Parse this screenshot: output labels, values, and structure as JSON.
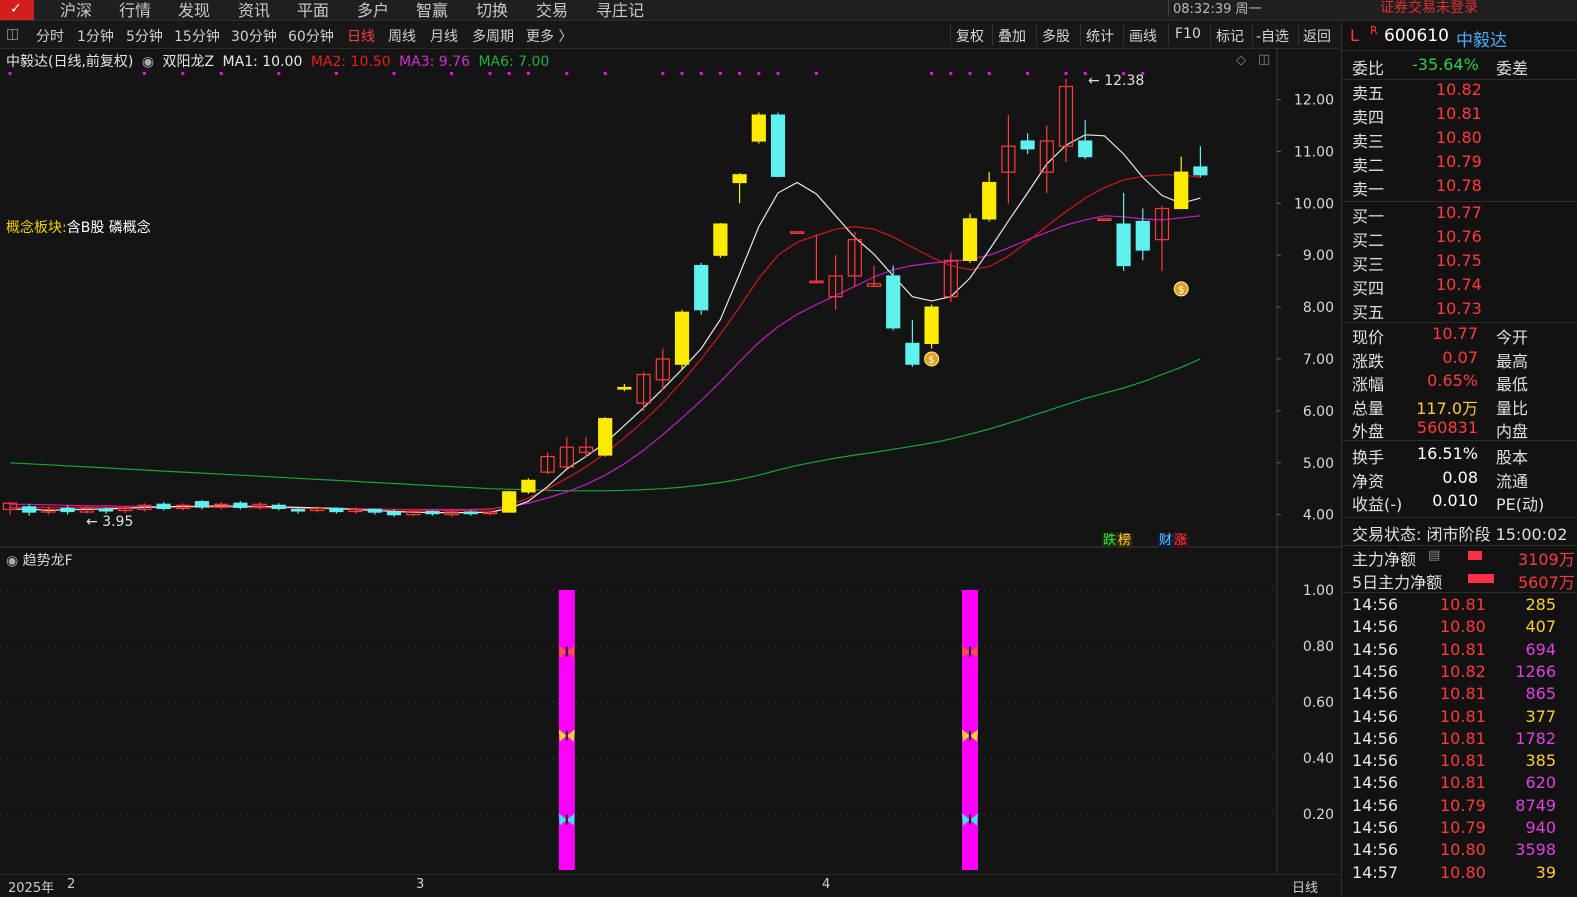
{
  "menu": {
    "items": [
      "沪深",
      "行情",
      "发现",
      "资讯",
      "平面",
      "多户",
      "智赢",
      "切换",
      "交易",
      "寻庄记"
    ],
    "clock": "08:32:39 周一",
    "warning": "证券交易未登录"
  },
  "toolbar": {
    "periods": [
      "分时",
      "1分钟",
      "5分钟",
      "15分钟",
      "30分钟",
      "60分钟",
      "日线",
      "周线",
      "月线",
      "多周期",
      "更多 〉"
    ],
    "active_period": "日线",
    "right_tools": [
      "复权",
      "叠加",
      "多股",
      "统计",
      "画线",
      "F10",
      "标记",
      "-自选",
      "返回"
    ]
  },
  "legend": {
    "stock": "中毅达(日线,前复权)",
    "indicator": "双阳龙Z",
    "ma1": "MA1: 10.00",
    "ma2": "MA2: 10.50",
    "ma3": "MA3: 9.76",
    "ma6": "MA6: 7.00"
  },
  "concept": {
    "label": "概念板块:",
    "value": "含B股 磷概念"
  },
  "annotations": {
    "high": "12.38",
    "low": "3.95",
    "badge1": "跌",
    "badge2": "榜",
    "badge3": "财",
    "badge4": "涨",
    "coin": "$"
  },
  "sub_indicator": "趋势龙F",
  "x_labels": [
    "2025年",
    "2",
    "3",
    "4"
  ],
  "x_period": "日线",
  "colors": {
    "up": "#ff3b3b",
    "down": "#5ff0f0",
    "yellow": "#ffeb00",
    "ma1": "#e8e8e8",
    "ma2": "#d01818",
    "ma3": "#c020c0",
    "ma6": "#17a53a",
    "magenta": "#ff00ff"
  },
  "chart_data": [
    {
      "type": "candlestick",
      "y_ticks": [
        "12.00",
        "11.00",
        "10.00",
        "9.00",
        "8.00",
        "7.00",
        "6.00",
        "5.00",
        "4.00"
      ],
      "ylim": [
        3.55,
        12.8
      ],
      "candles": [
        [
          4.1,
          4.22,
          4.0,
          4.25
        ],
        [
          4.15,
          4.05,
          3.98,
          4.2
        ],
        [
          4.05,
          4.1,
          4.0,
          4.16
        ],
        [
          4.12,
          4.06,
          4.0,
          4.18
        ],
        [
          4.05,
          4.12,
          4.02,
          4.16
        ],
        [
          4.1,
          4.08,
          4.02,
          4.14
        ],
        [
          4.08,
          4.12,
          4.03,
          4.16
        ],
        [
          4.1,
          4.18,
          4.06,
          4.22
        ],
        [
          4.2,
          4.12,
          4.08,
          4.24
        ],
        [
          4.12,
          4.18,
          4.08,
          4.22
        ],
        [
          4.25,
          4.15,
          4.1,
          4.28
        ],
        [
          4.15,
          4.2,
          4.1,
          4.24
        ],
        [
          4.22,
          4.14,
          4.1,
          4.26
        ],
        [
          4.15,
          4.2,
          4.1,
          4.24
        ],
        [
          4.18,
          4.12,
          4.08,
          4.22
        ],
        [
          4.1,
          4.08,
          4.02,
          4.14
        ],
        [
          4.08,
          4.12,
          4.04,
          4.16
        ],
        [
          4.12,
          4.06,
          4.02,
          4.14
        ],
        [
          4.06,
          4.1,
          4.02,
          4.14
        ],
        [
          4.1,
          4.05,
          4.0,
          4.12
        ],
        [
          4.05,
          4.0,
          3.96,
          4.1
        ],
        [
          4.0,
          4.06,
          3.97,
          4.1
        ],
        [
          4.06,
          4.02,
          3.98,
          4.08
        ],
        [
          4.0,
          4.05,
          3.96,
          4.08
        ],
        [
          4.05,
          4.02,
          3.98,
          4.08
        ],
        [
          4.02,
          4.05,
          3.98,
          4.08
        ],
        [
          4.05,
          4.44,
          4.04,
          4.46
        ],
        [
          4.44,
          4.66,
          4.4,
          4.7
        ],
        [
          4.82,
          5.12,
          4.78,
          5.2
        ],
        [
          4.92,
          5.3,
          4.9,
          5.5
        ],
        [
          5.2,
          5.3,
          5.1,
          5.5
        ],
        [
          5.15,
          5.85,
          5.12,
          5.88
        ],
        [
          6.45,
          6.44,
          6.38,
          6.52
        ],
        [
          6.15,
          6.7,
          6.0,
          6.75
        ],
        [
          6.6,
          7.0,
          6.4,
          7.2
        ],
        [
          6.9,
          7.9,
          6.8,
          7.95
        ],
        [
          8.8,
          7.95,
          7.85,
          8.85
        ],
        [
          9.6,
          9.0,
          8.95,
          9.62
        ],
        [
          10.55,
          10.4,
          10.0,
          10.58
        ],
        [
          11.7,
          11.2,
          11.15,
          11.75
        ],
        [
          11.7,
          10.52,
          10.5,
          11.75
        ],
        [
          9.45,
          9.45,
          9.45,
          9.45
        ],
        [
          8.5,
          8.5,
          8.5,
          9.4
        ],
        [
          8.2,
          8.6,
          7.95,
          9.0
        ],
        [
          8.6,
          9.3,
          8.4,
          9.45
        ],
        [
          8.4,
          8.45,
          8.4,
          8.8
        ],
        [
          8.6,
          7.6,
          7.55,
          8.8
        ],
        [
          7.3,
          6.9,
          6.85,
          7.75
        ],
        [
          7.3,
          8.0,
          7.2,
          8.05
        ],
        [
          8.2,
          8.9,
          8.1,
          9.05
        ],
        [
          8.9,
          9.7,
          8.85,
          9.8
        ],
        [
          9.7,
          10.4,
          9.65,
          10.6
        ],
        [
          10.6,
          11.1,
          10.0,
          11.7
        ],
        [
          11.2,
          11.05,
          10.95,
          11.35
        ],
        [
          10.6,
          11.2,
          10.2,
          11.5
        ],
        [
          11.1,
          12.25,
          10.8,
          12.4
        ],
        [
          11.2,
          10.9,
          10.85,
          11.6
        ],
        [
          9.7,
          9.7,
          9.7,
          9.7
        ],
        [
          9.6,
          8.8,
          8.7,
          10.2
        ],
        [
          9.65,
          9.1,
          8.9,
          9.9
        ],
        [
          9.3,
          9.9,
          8.7,
          9.95
        ],
        [
          9.9,
          10.6,
          9.9,
          10.9
        ],
        [
          10.7,
          10.55,
          10.5,
          11.1
        ]
      ],
      "ma1": [
        4.1,
        4.11,
        4.08,
        4.1,
        4.1,
        4.11,
        4.12,
        4.14,
        4.15,
        4.16,
        4.16,
        4.17,
        4.16,
        4.16,
        4.15,
        4.14,
        4.13,
        4.12,
        4.1,
        4.08,
        4.06,
        4.05,
        4.04,
        4.04,
        4.04,
        4.05,
        4.12,
        4.26,
        4.54,
        4.88,
        5.12,
        5.38,
        5.72,
        6.06,
        6.42,
        6.8,
        7.2,
        7.76,
        8.64,
        9.55,
        10.2,
        10.4,
        10.18,
        9.76,
        9.34,
        9.02,
        8.6,
        8.2,
        8.12,
        8.2,
        8.56,
        9.1,
        9.66,
        10.2,
        10.76,
        11.12,
        11.32,
        11.3,
        10.95,
        10.5,
        10.15,
        10.0,
        10.1
      ],
      "ma2": [
        4.14,
        4.14,
        4.14,
        4.14,
        4.14,
        4.14,
        4.14,
        4.14,
        4.14,
        4.14,
        4.14,
        4.14,
        4.14,
        4.13,
        4.13,
        4.12,
        4.12,
        4.11,
        4.1,
        4.1,
        4.09,
        4.09,
        4.08,
        4.08,
        4.08,
        4.1,
        4.18,
        4.32,
        4.5,
        4.7,
        4.92,
        5.18,
        5.48,
        5.8,
        6.16,
        6.56,
        7.0,
        7.48,
        8.0,
        8.55,
        9.0,
        9.25,
        9.38,
        9.5,
        9.55,
        9.5,
        9.35,
        9.15,
        8.96,
        8.8,
        8.72,
        8.78,
        8.98,
        9.26,
        9.56,
        9.84,
        10.1,
        10.3,
        10.45,
        10.52,
        10.55,
        10.55,
        10.5
      ],
      "ma3": [
        4.2,
        4.2,
        4.19,
        4.18,
        4.17,
        4.17,
        4.16,
        4.16,
        4.15,
        4.15,
        4.15,
        4.14,
        4.14,
        4.14,
        4.13,
        4.13,
        4.12,
        4.12,
        4.11,
        4.11,
        4.1,
        4.1,
        4.1,
        4.1,
        4.1,
        4.11,
        4.15,
        4.22,
        4.32,
        4.44,
        4.58,
        4.76,
        4.98,
        5.24,
        5.54,
        5.86,
        6.2,
        6.56,
        6.95,
        7.32,
        7.62,
        7.86,
        8.05,
        8.22,
        8.4,
        8.58,
        8.72,
        8.8,
        8.85,
        8.88,
        8.92,
        9.0,
        9.14,
        9.3,
        9.44,
        9.58,
        9.68,
        9.76,
        9.74,
        9.7,
        9.68,
        9.72,
        9.76
      ],
      "ma6": [
        5.0,
        4.98,
        4.96,
        4.94,
        4.92,
        4.9,
        4.88,
        4.86,
        4.84,
        4.82,
        4.8,
        4.78,
        4.76,
        4.74,
        4.72,
        4.7,
        4.68,
        4.66,
        4.64,
        4.62,
        4.6,
        4.58,
        4.56,
        4.54,
        4.52,
        4.5,
        4.49,
        4.48,
        4.47,
        4.46,
        4.46,
        4.46,
        4.47,
        4.48,
        4.5,
        4.53,
        4.57,
        4.62,
        4.68,
        4.76,
        4.86,
        4.95,
        5.02,
        5.09,
        5.15,
        5.2,
        5.26,
        5.32,
        5.38,
        5.46,
        5.55,
        5.65,
        5.76,
        5.88,
        6.0,
        6.12,
        6.24,
        6.34,
        6.44,
        6.56,
        6.7,
        6.84,
        7.0
      ]
    },
    {
      "type": "bar",
      "y_ticks": [
        "1.00",
        "0.80",
        "0.60",
        "0.40",
        "0.20"
      ],
      "ylim": [
        0,
        1.05
      ],
      "signal_bars": [
        {
          "index": 29,
          "value": 1.0
        },
        {
          "index": 50,
          "value": 1.0
        }
      ]
    }
  ],
  "panel": {
    "code": "600610",
    "name": "中毅达",
    "webi_label": "委比",
    "webi_value": "-35.64%",
    "weicha_label": "委差",
    "sells": [
      [
        "卖五",
        "10.82"
      ],
      [
        "卖四",
        "10.81"
      ],
      [
        "卖三",
        "10.80"
      ],
      [
        "卖二",
        "10.79"
      ],
      [
        "卖一",
        "10.78"
      ]
    ],
    "buys": [
      [
        "买一",
        "10.77"
      ],
      [
        "买二",
        "10.76"
      ],
      [
        "买三",
        "10.75"
      ],
      [
        "买四",
        "10.74"
      ],
      [
        "买五",
        "10.73"
      ]
    ],
    "stats": [
      [
        "现价",
        "10.77",
        "今开"
      ],
      [
        "涨跌",
        "0.07",
        "最高"
      ],
      [
        "涨幅",
        "0.65%",
        "最低"
      ],
      [
        "总量",
        "117.0万",
        "量比"
      ],
      [
        "外盘",
        "560831",
        "内盘"
      ]
    ],
    "stats2": [
      [
        "换手",
        "16.51%",
        "股本"
      ],
      [
        "净资",
        "0.08",
        "流通"
      ],
      [
        "收益(-)",
        "0.010",
        "PE(动)"
      ]
    ],
    "status": "交易状态: 闭市阶段 15:00:02",
    "flow1_label": "主力净额",
    "flow1_value": "3109万",
    "flow2_label": "5日主力净额",
    "flow2_value": "5607万",
    "ticks": [
      [
        "14:56",
        "10.81",
        "285"
      ],
      [
        "14:56",
        "10.80",
        "407"
      ],
      [
        "14:56",
        "10.81",
        "694"
      ],
      [
        "14:56",
        "10.82",
        "1266"
      ],
      [
        "14:56",
        "10.81",
        "865"
      ],
      [
        "14:56",
        "10.81",
        "377"
      ],
      [
        "14:56",
        "10.81",
        "1782"
      ],
      [
        "14:56",
        "10.81",
        "385"
      ],
      [
        "14:56",
        "10.81",
        "620"
      ],
      [
        "14:56",
        "10.79",
        "8749"
      ],
      [
        "14:56",
        "10.79",
        "940"
      ],
      [
        "14:56",
        "10.80",
        "3598"
      ],
      [
        "14:57",
        "10.80",
        "39"
      ]
    ]
  }
}
